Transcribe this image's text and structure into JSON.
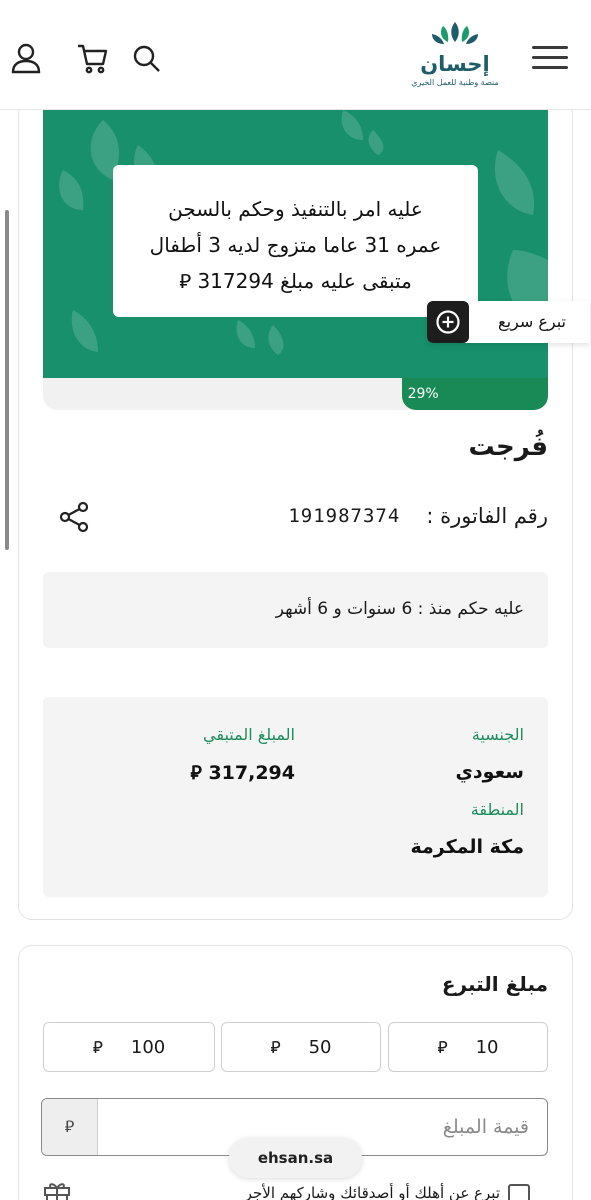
{
  "header": {
    "logo_name": "إحسان",
    "logo_tagline": "منصة وطنية للعمل الخيري"
  },
  "banner": {
    "line1": "عليه امر بالتنفيذ وحكم بالسجن",
    "line2": "عمره 31 عاما متزوج لديه 3 أطفال",
    "line3": "متبقى عليه مبلغ 317294 ⃁",
    "progress_percent": 29,
    "progress_label": "29%"
  },
  "quick_donate": {
    "label": "تبرع سريع"
  },
  "case": {
    "title": "فُرجت",
    "invoice_label": "رقم الفاتورة :",
    "invoice_number": "191987374",
    "sentence": "عليه حكم منذ : 6 سنوات و 6 أشهر",
    "nationality_label": "الجنسية",
    "nationality_value": "سعودي",
    "remaining_label": "المبلغ المتبقي",
    "remaining_value": "317,294 ⃁",
    "region_label": "المنطقة",
    "region_value": "مكة المكرمة"
  },
  "donation": {
    "title": "مبلغ التبرع",
    "amounts": [
      "10",
      "50",
      "100"
    ],
    "currency_symbol": "⃁",
    "amount_placeholder": "قيمة المبلغ",
    "gift_text": "تبرع عن أهلك أو أصدقائك وشاركهم الأجر"
  },
  "browser": {
    "url": "ehsan.sa"
  },
  "colors": {
    "banner_green": "#17906b",
    "progress_green": "#198a55",
    "label_green": "#1e8c5c",
    "logo_teal": "#1f5c6a"
  }
}
